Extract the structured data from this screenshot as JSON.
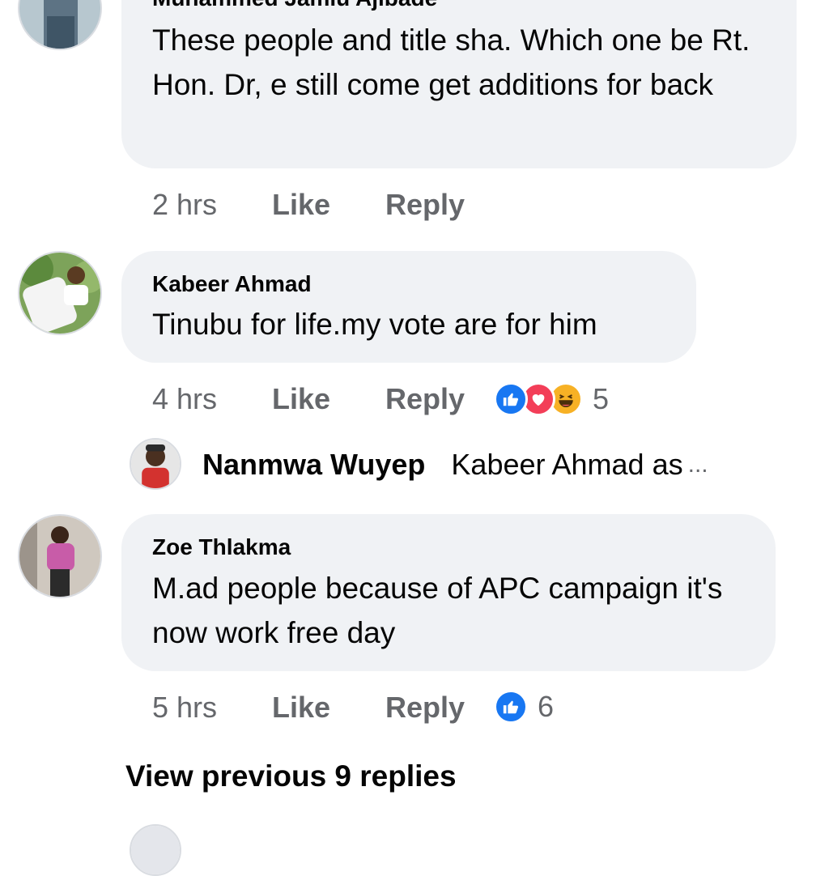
{
  "comments": [
    {
      "author": "Muhammed Jamiu Ajibade",
      "text": "These people and title sha. Which one be Rt. Hon. Dr, e still come get additions for back",
      "time": "2 hrs",
      "like_label": "Like",
      "reply_label": "Reply"
    },
    {
      "author": "Kabeer Ahmad",
      "text": "Tinubu for life.my vote are for him",
      "time": "4 hrs",
      "like_label": "Like",
      "reply_label": "Reply",
      "reactions": {
        "icons": [
          "like-icon",
          "love-icon",
          "haha-icon"
        ],
        "count": "5"
      },
      "reply_preview": {
        "name": "Nanmwa Wuyep",
        "text": "Kabeer Ahmad as",
        "ellipsis": "..."
      }
    },
    {
      "author": "Zoe Thlakma",
      "text": "M.ad people because of APC campaign it's now work free day",
      "time": "5 hrs",
      "like_label": "Like",
      "reply_label": "Reply",
      "reactions": {
        "icons": [
          "like-icon"
        ],
        "count": "6"
      }
    }
  ],
  "view_previous_label": "View previous 9 replies",
  "colors": {
    "bubble_bg": "#f0f2f5",
    "meta_text": "#65676b",
    "like_blue": "#1877f2",
    "love_red": "#f33e58",
    "haha_yellow": "#f7b125"
  }
}
